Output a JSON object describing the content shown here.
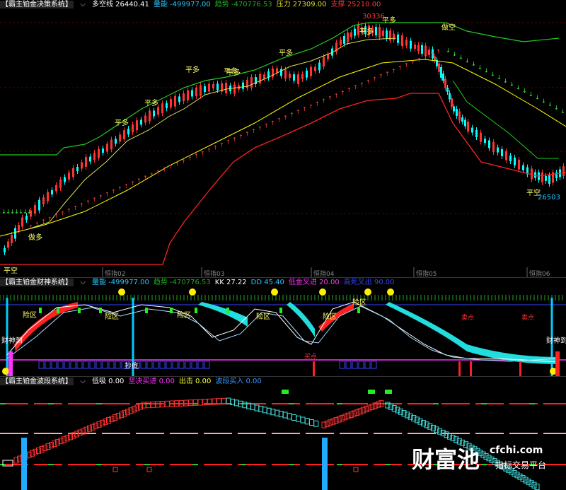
{
  "panels": {
    "top": {
      "title": "【霸主铂金决策系统】",
      "items": [
        {
          "label": "多空线",
          "value": "26440.41",
          "color": "#ffffff"
        },
        {
          "label": "量能",
          "value": "-499977.00",
          "color": "#27c7ff"
        },
        {
          "label": "趋势",
          "value": "-470776.53",
          "color": "#22aa22"
        },
        {
          "label": "压力",
          "value": "27309.00",
          "color": "#dddd22"
        },
        {
          "label": "支撑",
          "value": "25210.00",
          "color": "#ff3333"
        }
      ],
      "price_high": "30336",
      "price_low": "26503",
      "signals": [
        "平多",
        "平多",
        "平多",
        "平多",
        "平多",
        "平多",
        "平多",
        "平多",
        "做多",
        "平空",
        "做空",
        "平空"
      ],
      "x_labels": [
        "恒指02",
        "恒指03",
        "恒指04",
        "恒指05",
        "恒指06"
      ]
    },
    "mid": {
      "title": "【霸主铂金财神系统】",
      "items": [
        {
          "label": "量能",
          "value": "-499977.00",
          "color": "#27c7ff"
        },
        {
          "label": "趋势",
          "value": "-470776.53",
          "color": "#22aa22"
        },
        {
          "label": "KK",
          "value": "27.22",
          "color": "#ffffff"
        },
        {
          "label": "DD",
          "value": "45.40",
          "color": "#27c7ff"
        },
        {
          "label": "低金叉进",
          "value": "20.00",
          "color": "#ff33ff"
        },
        {
          "label": "高死叉出",
          "value": "90.00",
          "color": "#3344ff"
        }
      ],
      "zone_labels": [
        "险区",
        "险区",
        "险区",
        "险区",
        "险区",
        "险区"
      ],
      "text_labels": [
        "财神到",
        "财神到",
        "抄底",
        "买点",
        "卖点",
        "卖点"
      ]
    },
    "bottom": {
      "title": "【霸主铂金波段系统】",
      "items": [
        {
          "label": "低吸",
          "value": "0.00",
          "color": "#ffffff"
        },
        {
          "label": "坚决买进",
          "value": "0.00",
          "color": "#ff33ff"
        },
        {
          "label": "出击",
          "value": "0.00",
          "color": "#ffff33"
        },
        {
          "label": "波段买入",
          "value": "0.00",
          "color": "#3399ff"
        }
      ]
    }
  },
  "watermark": {
    "brand": "财富池",
    "site": "cfchi.com",
    "tagline": "指标交易平台"
  }
}
